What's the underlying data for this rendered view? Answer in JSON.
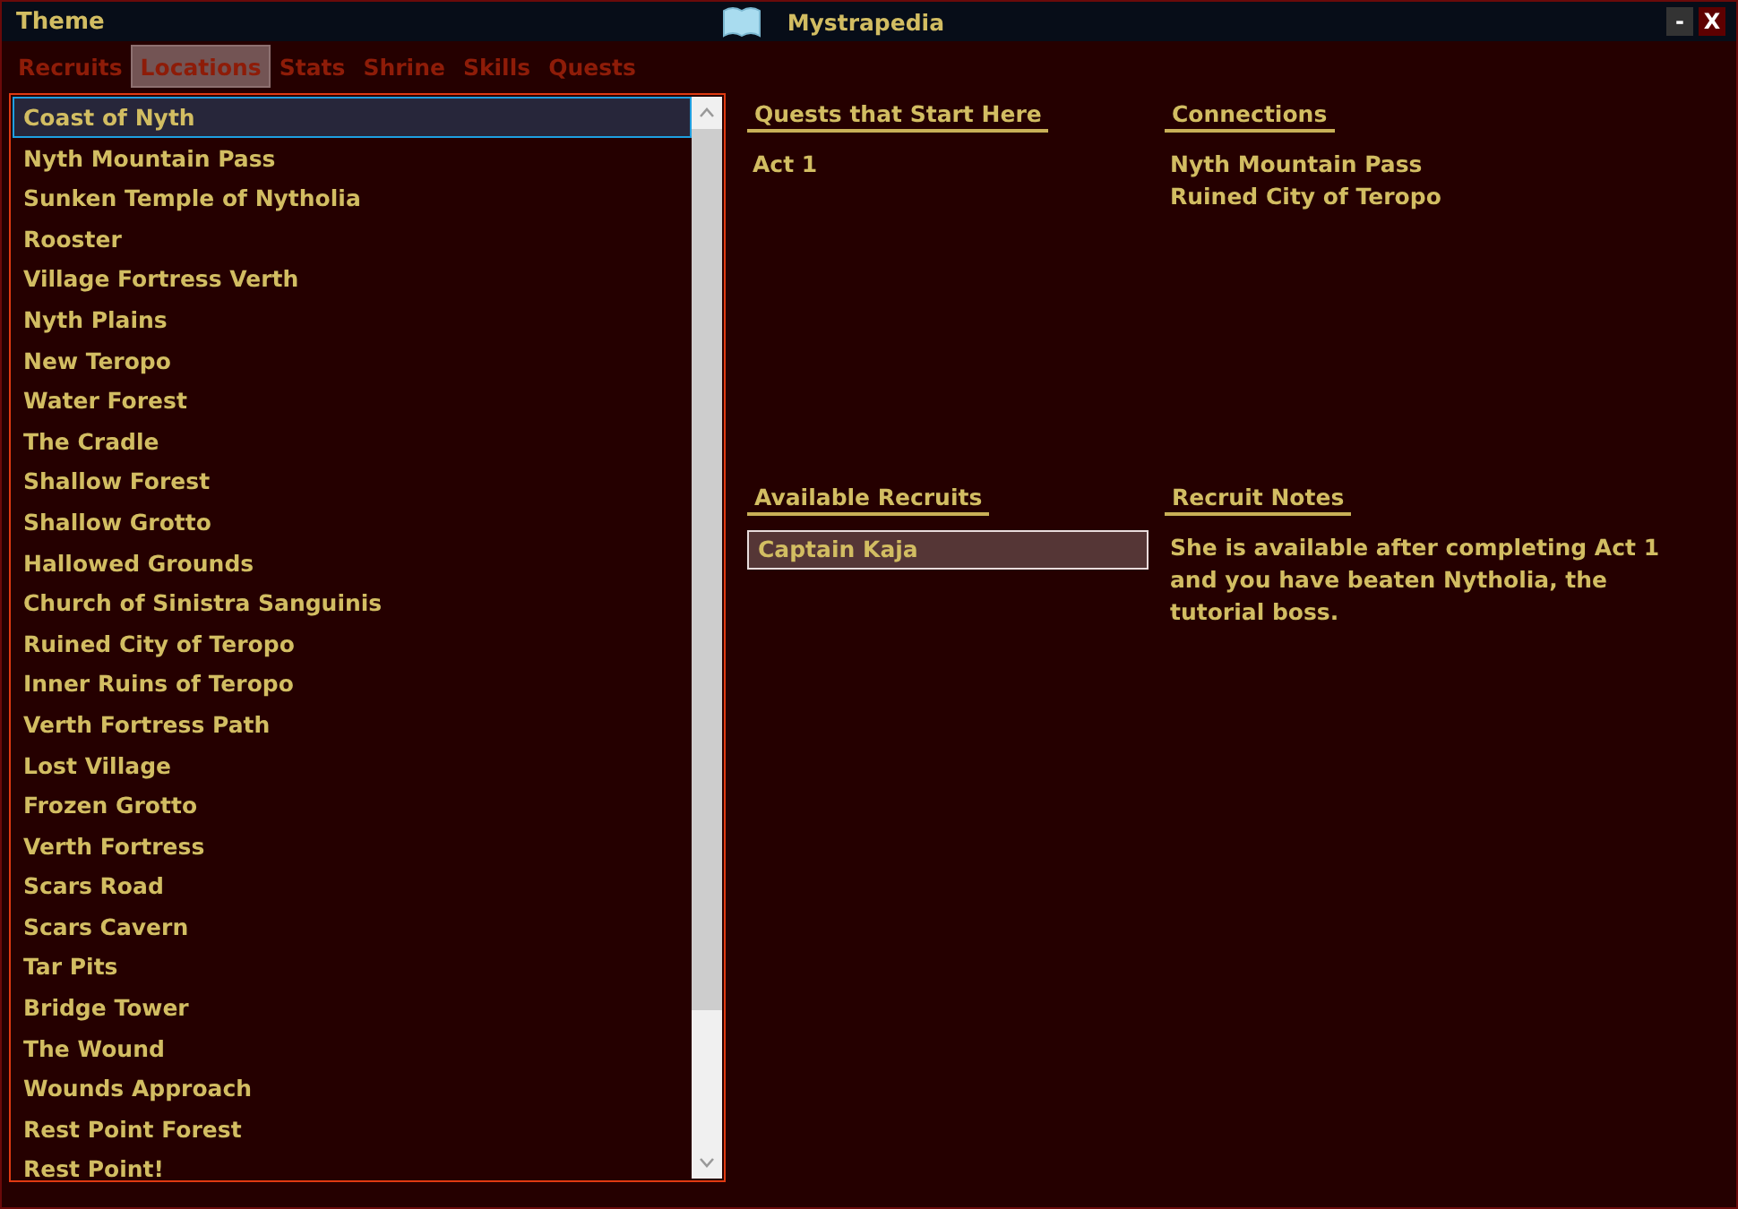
{
  "title_bar": {
    "menu": "Theme",
    "title": "Mystrapedia",
    "minimize": "-",
    "close": "X"
  },
  "tabs": [
    {
      "label": "Recruits",
      "selected": false
    },
    {
      "label": "Locations",
      "selected": true
    },
    {
      "label": "Stats",
      "selected": false
    },
    {
      "label": "Shrine",
      "selected": false
    },
    {
      "label": "Skills",
      "selected": false
    },
    {
      "label": "Quests",
      "selected": false
    }
  ],
  "locations": [
    {
      "name": "Coast of Nyth",
      "selected": true
    },
    {
      "name": "Nyth Mountain Pass",
      "selected": false
    },
    {
      "name": "Sunken Temple of Nytholia",
      "selected": false
    },
    {
      "name": "Rooster",
      "selected": false
    },
    {
      "name": "Village Fortress Verth",
      "selected": false
    },
    {
      "name": "Nyth Plains",
      "selected": false
    },
    {
      "name": "New Teropo",
      "selected": false
    },
    {
      "name": "Water Forest",
      "selected": false
    },
    {
      "name": "The Cradle",
      "selected": false
    },
    {
      "name": "Shallow Forest",
      "selected": false
    },
    {
      "name": "Shallow Grotto",
      "selected": false
    },
    {
      "name": "Hallowed Grounds",
      "selected": false
    },
    {
      "name": "Church of Sinistra Sanguinis",
      "selected": false
    },
    {
      "name": "Ruined City of Teropo",
      "selected": false
    },
    {
      "name": "Inner Ruins of Teropo",
      "selected": false
    },
    {
      "name": "Verth Fortress Path",
      "selected": false
    },
    {
      "name": "Lost Village",
      "selected": false
    },
    {
      "name": "Frozen Grotto",
      "selected": false
    },
    {
      "name": "Verth Fortress",
      "selected": false
    },
    {
      "name": "Scars Road",
      "selected": false
    },
    {
      "name": "Scars Cavern",
      "selected": false
    },
    {
      "name": "Tar Pits",
      "selected": false
    },
    {
      "name": "Bridge Tower",
      "selected": false
    },
    {
      "name": "The Wound",
      "selected": false
    },
    {
      "name": "Wounds Approach",
      "selected": false
    },
    {
      "name": "Rest Point Forest",
      "selected": false
    },
    {
      "name": "Rest Point!",
      "selected": false
    }
  ],
  "quests": {
    "heading": "Quests that Start Here",
    "items": [
      "Act 1"
    ]
  },
  "connections": {
    "heading": "Connections",
    "items": [
      "Nyth Mountain Pass",
      "Ruined City of Teropo"
    ]
  },
  "available_recruits": {
    "heading": "Available Recruits",
    "items": [
      {
        "name": "Captain Kaja",
        "selected": true
      }
    ]
  },
  "recruit_notes": {
    "heading": "Recruit Notes",
    "text": "She is available after completing Act 1 and you have beaten Nytholia, the tutorial boss."
  }
}
